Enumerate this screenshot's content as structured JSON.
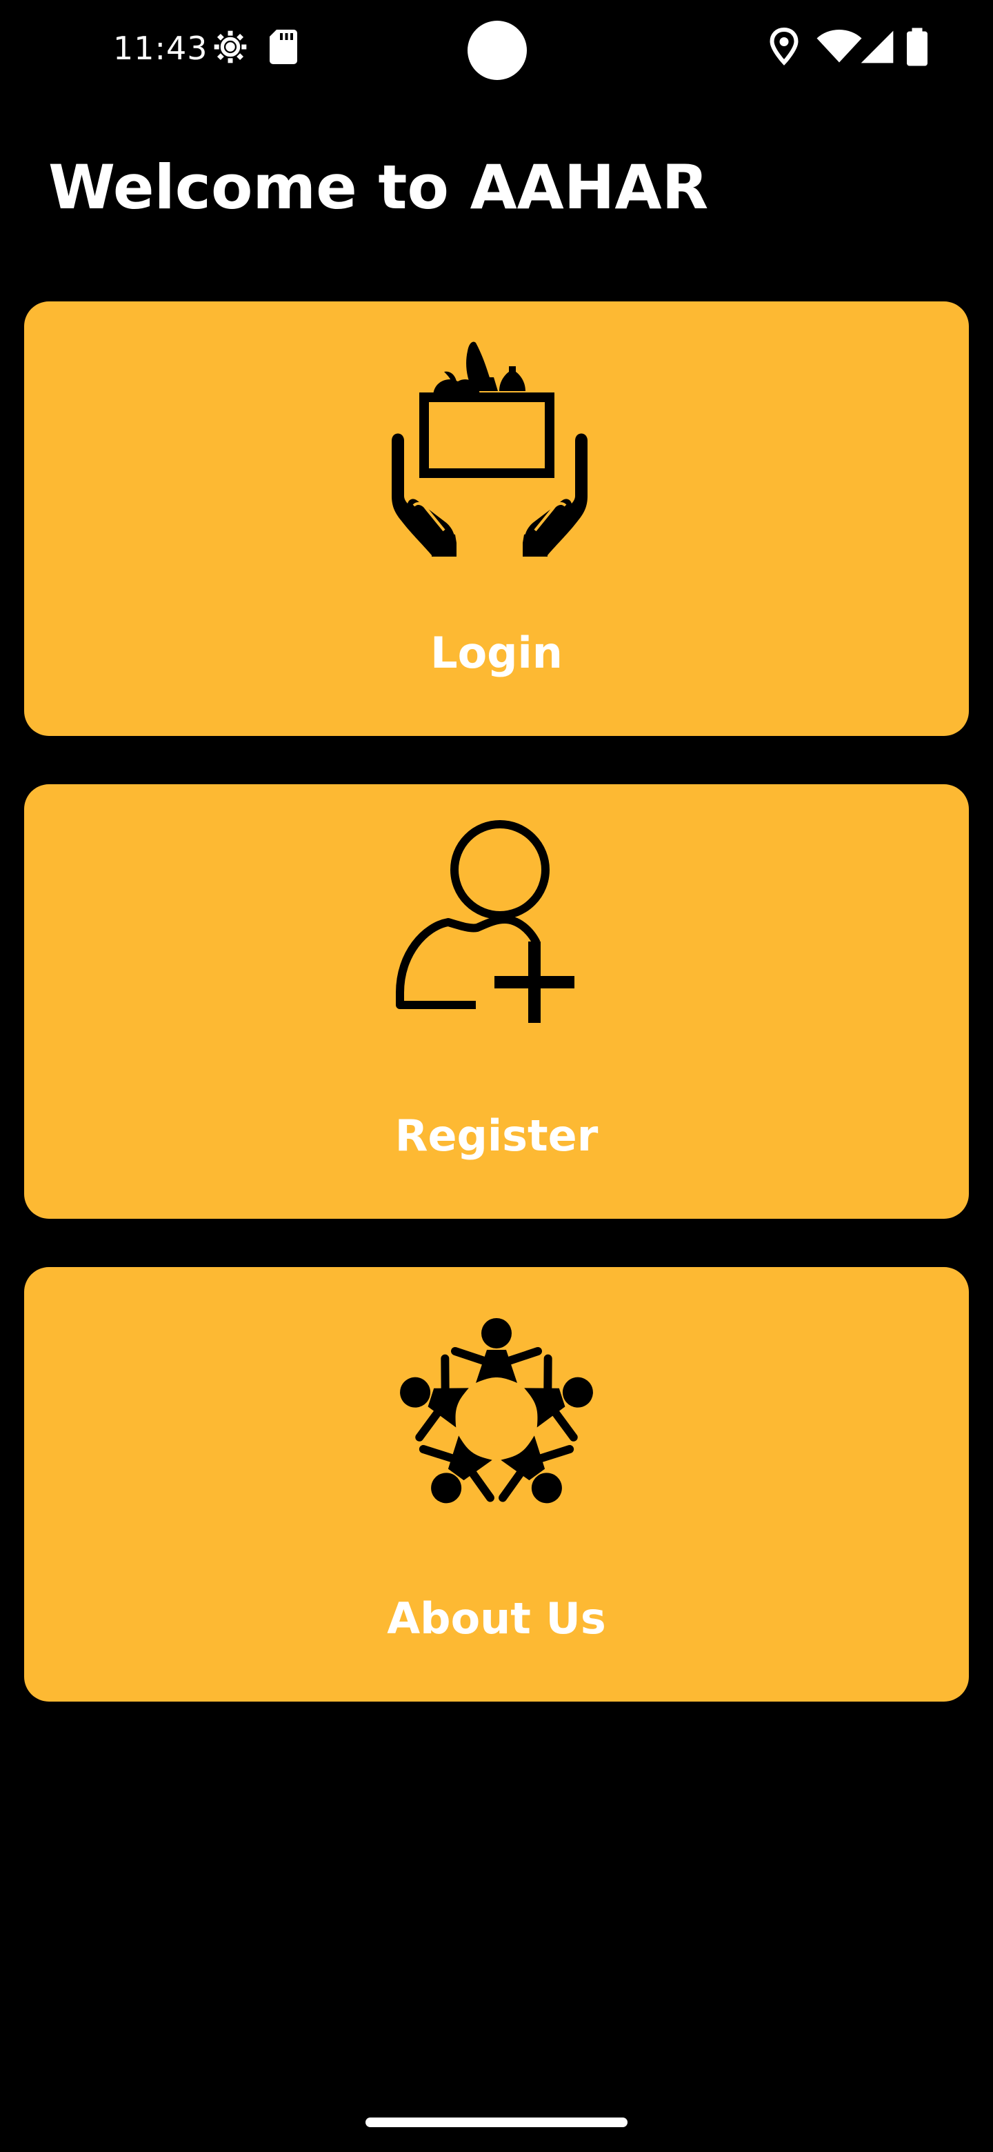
{
  "status_bar": {
    "time": "11:43",
    "icons_left": [
      "settings-gear-icon",
      "sd-card-icon"
    ],
    "icons_right": [
      "location-icon",
      "wifi-icon",
      "cell-signal-icon",
      "battery-icon"
    ]
  },
  "header": {
    "title": "Welcome to AAHAR"
  },
  "cards": [
    {
      "label": "Login",
      "icon": "food-donation-hands-icon"
    },
    {
      "label": "Register",
      "icon": "add-user-icon"
    },
    {
      "label": "About Us",
      "icon": "community-circle-icon"
    }
  ],
  "colors": {
    "background": "#000000",
    "card": "#fdb933",
    "icon": "#000000",
    "text": "#ffffff"
  }
}
